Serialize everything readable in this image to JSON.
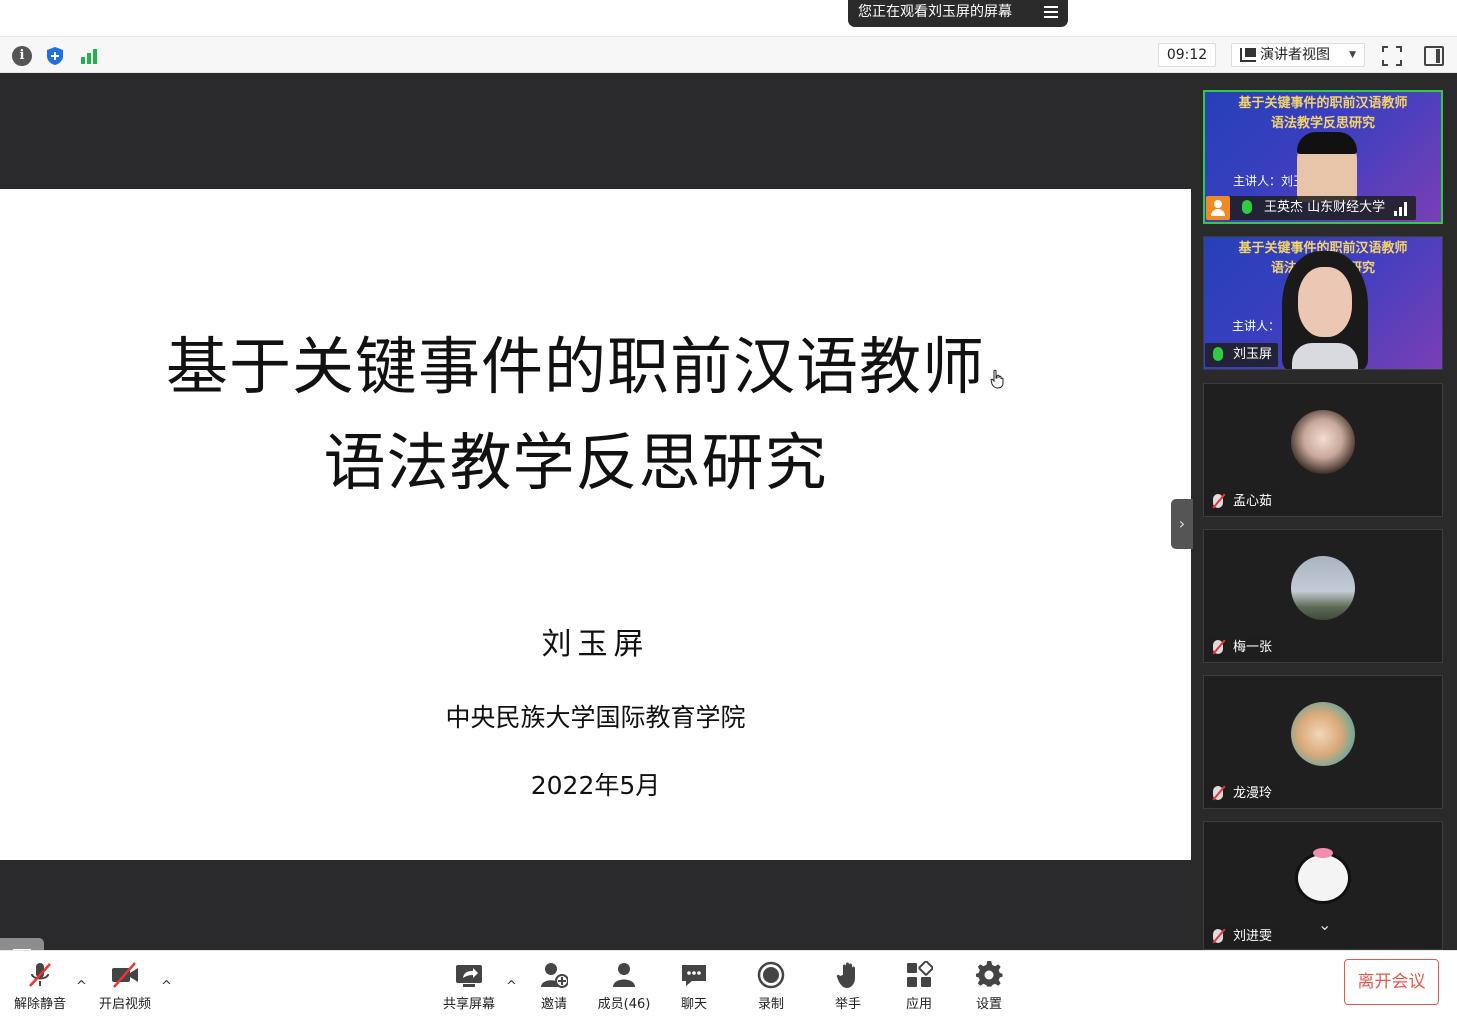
{
  "banner": {
    "text": "您正在观看刘玉屏的屏幕"
  },
  "toolbar": {
    "timer": "09:12",
    "view_mode": "演讲者视图"
  },
  "slide": {
    "title_line1": "基于关键事件的职前汉语教师",
    "title_line2": "语法教学反思研究",
    "presenter": "刘玉屏",
    "institution": "中央民族大学国际教育学院",
    "date": "2022年5月"
  },
  "participants": [
    {
      "name": "王英杰 山东财经大学",
      "mic": "on",
      "video": true,
      "video_title1": "基于关键事件的职前汉语教师",
      "video_title2": "语法教学反思研究",
      "video_sub": "主讲人：刘玉"
    },
    {
      "name": "刘玉屏",
      "mic": "on",
      "video": true,
      "video_title1": "基于关键事件的职前汉语教师",
      "video_title2": "语法教学反思研究",
      "video_sub": "主讲人："
    },
    {
      "name": "孟心茹",
      "mic": "muted",
      "video": false
    },
    {
      "name": "梅一张",
      "mic": "muted",
      "video": false
    },
    {
      "name": "龙漫玲",
      "mic": "muted",
      "video": false
    },
    {
      "name": "刘进雯",
      "mic": "muted",
      "video": false
    }
  ],
  "bottombar": {
    "unmute": "解除静音",
    "start_video": "开启视频",
    "share_screen": "共享屏幕",
    "invite": "邀请",
    "members": "成员(46)",
    "chat": "聊天",
    "record": "录制",
    "raise_hand": "举手",
    "apps": "应用",
    "settings": "设置",
    "leave": "离开会议"
  },
  "colors": {
    "accent_green": "#2ecc40",
    "leave_red": "#e05a4e",
    "banner_bg": "#2b2b2b"
  },
  "icons": [
    "info-icon",
    "shield-icon",
    "signal-icon",
    "fullscreen-icon",
    "panel-toggle-icon",
    "list-icon",
    "mic-muted-icon",
    "video-off-icon",
    "share-icon",
    "invite-icon",
    "members-icon",
    "chat-icon",
    "record-icon",
    "hand-icon",
    "apps-icon",
    "gear-icon"
  ]
}
